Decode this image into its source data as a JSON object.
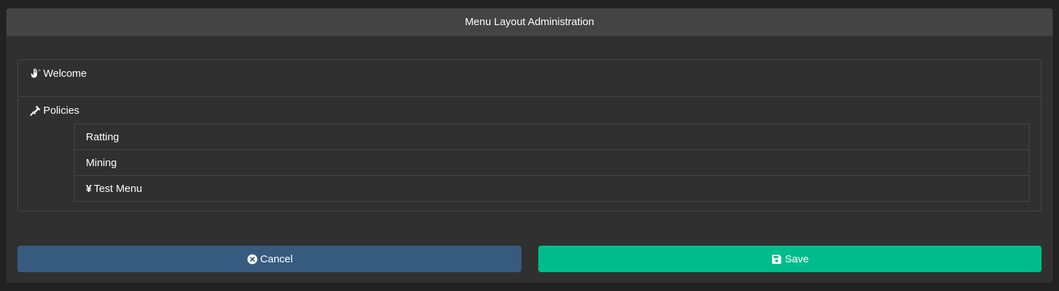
{
  "dialog": {
    "title": "Menu Layout Administration"
  },
  "menu": {
    "items": [
      {
        "label": "Welcome",
        "icon": "hand-wave-icon"
      },
      {
        "label": "Policies",
        "icon": "gavel-icon",
        "children": [
          {
            "label": "Ratting"
          },
          {
            "label": "Mining"
          },
          {
            "label": "Test Menu",
            "icon": "yen-icon",
            "icon_glyph": "¥"
          }
        ]
      }
    ]
  },
  "buttons": {
    "cancel_label": "Cancel",
    "cancel_icon": "times-circle-icon",
    "save_label": "Save",
    "save_icon": "floppy-disk-icon"
  },
  "colors": {
    "background": "#222222",
    "dialog": "#303030",
    "header": "#444444",
    "cancel": "#375a7f",
    "save": "#00bc8c"
  }
}
